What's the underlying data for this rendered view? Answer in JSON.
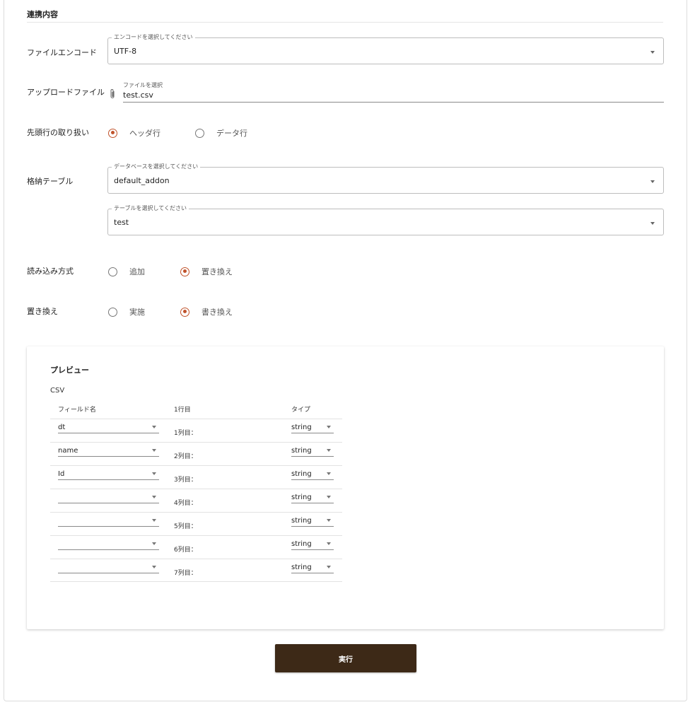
{
  "section": {
    "title": "連携内容"
  },
  "encode": {
    "label": "ファイルエンコード",
    "legend": "エンコードを選択してください",
    "value": "UTF-8"
  },
  "upload": {
    "label": "アップロードファイル",
    "field_label": "ファイルを選択",
    "value": "test.csv"
  },
  "header_row": {
    "label": "先頭行の取り扱い",
    "options": [
      {
        "label": "ヘッダ行",
        "checked": true
      },
      {
        "label": "データ行",
        "checked": false
      }
    ]
  },
  "table": {
    "label": "格納テーブル",
    "db_legend": "データベースを選択してください",
    "db_value": "default_addon",
    "table_legend": "テーブルを選択してください",
    "table_value": "test"
  },
  "load_mode": {
    "label": "読み込み方式",
    "options": [
      {
        "label": "追加",
        "checked": false
      },
      {
        "label": "置き換え",
        "checked": true
      }
    ]
  },
  "replace": {
    "label": "置き換え",
    "options": [
      {
        "label": "実施",
        "checked": false
      },
      {
        "label": "書き換え",
        "checked": true
      }
    ]
  },
  "preview": {
    "title": "プレビュー",
    "subtitle": "CSV",
    "columns": [
      "フィールド名",
      "1行目",
      "タイプ"
    ],
    "rows": [
      {
        "field": "dt",
        "col": "1列目：",
        "type": "string"
      },
      {
        "field": "name",
        "col": "2列目：",
        "type": "string"
      },
      {
        "field": "Id",
        "col": "3列目：",
        "type": "string"
      },
      {
        "field": "",
        "col": "4列目：",
        "type": "string"
      },
      {
        "field": "",
        "col": "5列目：",
        "type": "string"
      },
      {
        "field": "",
        "col": "6列目：",
        "type": "string"
      },
      {
        "field": "",
        "col": "7列目：",
        "type": "string"
      }
    ]
  },
  "actions": {
    "execute": "実行"
  },
  "colors": {
    "accent": "#c0532b",
    "button": "#3d2917"
  }
}
